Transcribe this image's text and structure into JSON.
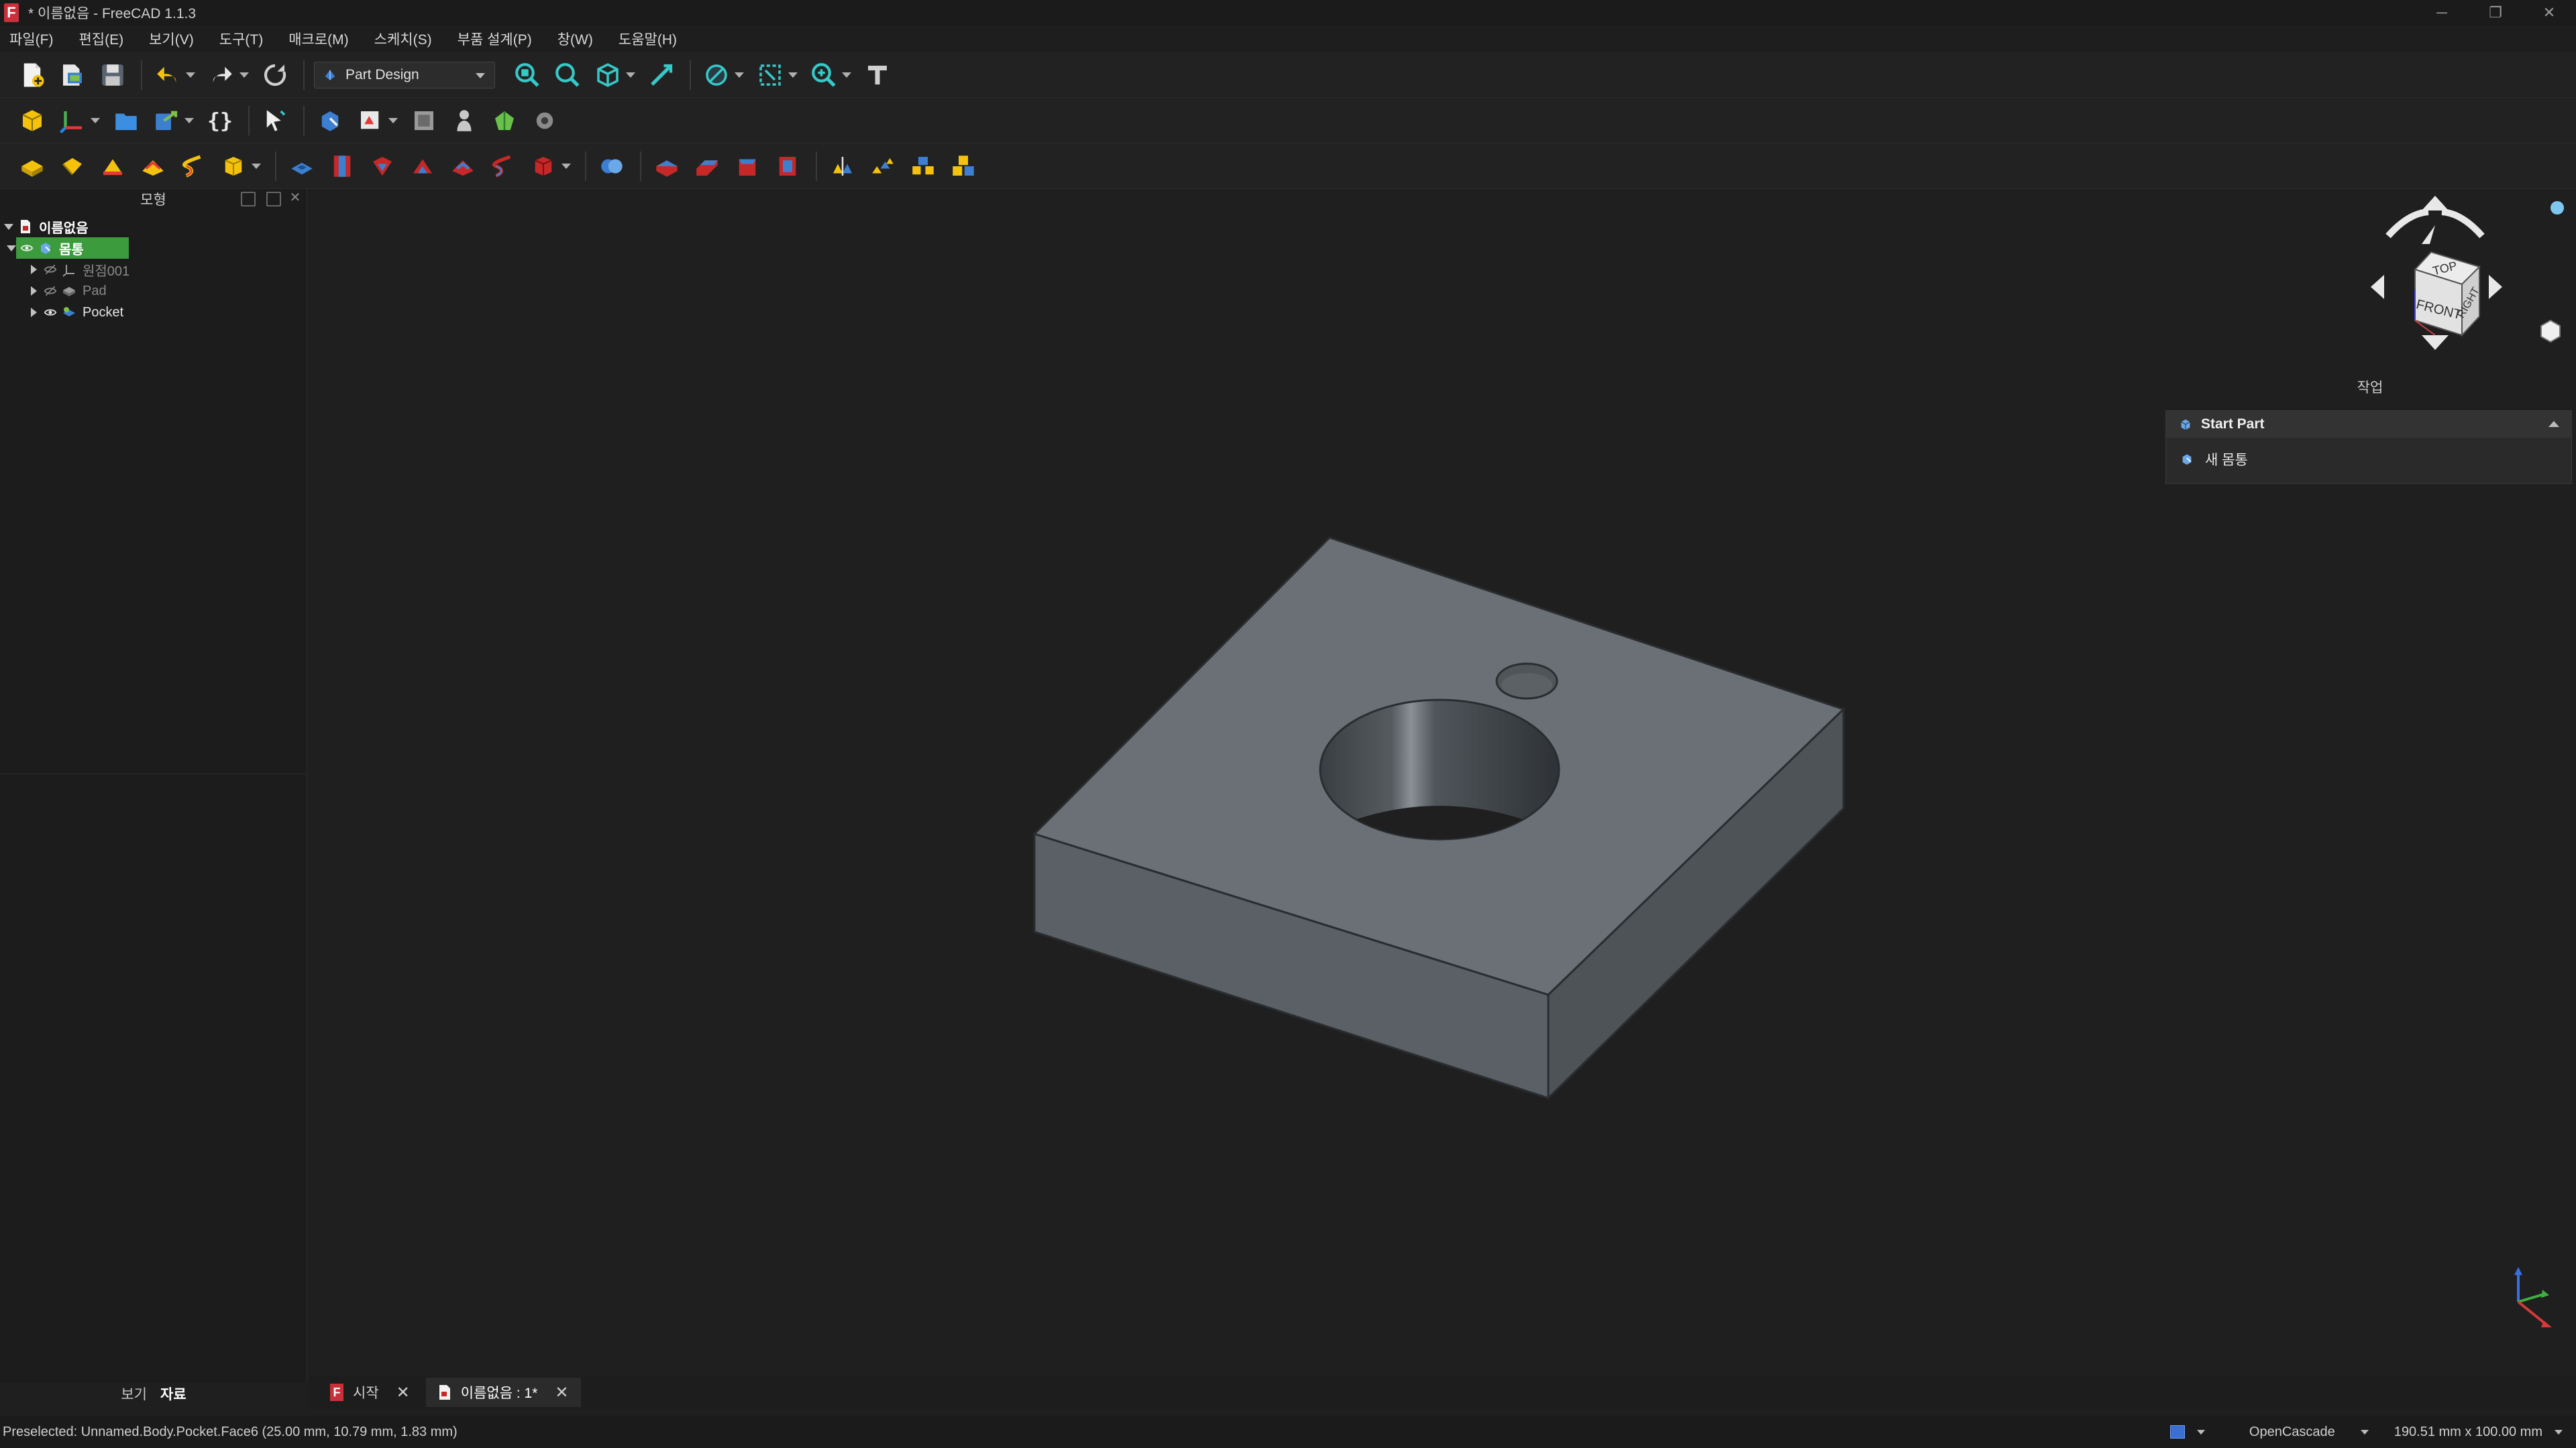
{
  "window": {
    "title": "* 이름없음 - FreeCAD 1.1.3",
    "app_icon_glyph": "F",
    "minimize": "─",
    "maximize": "❐",
    "close": "✕"
  },
  "menu": [
    "파일(F)",
    "편집(E)",
    "보기(V)",
    "도구(T)",
    "매크로(M)",
    "스케치(S)",
    "부품 설계(P)",
    "창(W)",
    "도움말(H)"
  ],
  "toolbar": {
    "workbench": "Part Design"
  },
  "model_panel": {
    "title": "모형",
    "tree": {
      "document": "이름없음",
      "body": "몸통",
      "children": [
        "원점001",
        "Pad",
        "Pocket"
      ]
    },
    "tabs": [
      "보기",
      "자료"
    ],
    "active_tab": "자료"
  },
  "task_panel": {
    "title": "작업",
    "section": "Start Part",
    "item": "새 몸통"
  },
  "navcube": {
    "top": "TOP",
    "front": "FRONT",
    "right": "RIGHT"
  },
  "doc_tabs": [
    {
      "label": "시작",
      "close": "✕"
    },
    {
      "label": "이름없음 : 1*",
      "close": "✕"
    }
  ],
  "status": {
    "preselected": "Preselected: Unnamed.Body.Pocket.Face6 (25.00 mm, 10.79 mm, 1.83 mm)",
    "kernel": "OpenCascade",
    "dimensions": "190.51 mm x 100.00 mm"
  },
  "colors": {
    "accent_green": "#3c9b3c",
    "model_top": "#6a7075",
    "model_left": "#5a6066",
    "model_right": "#4e5358",
    "background": "#1f1f1f"
  }
}
